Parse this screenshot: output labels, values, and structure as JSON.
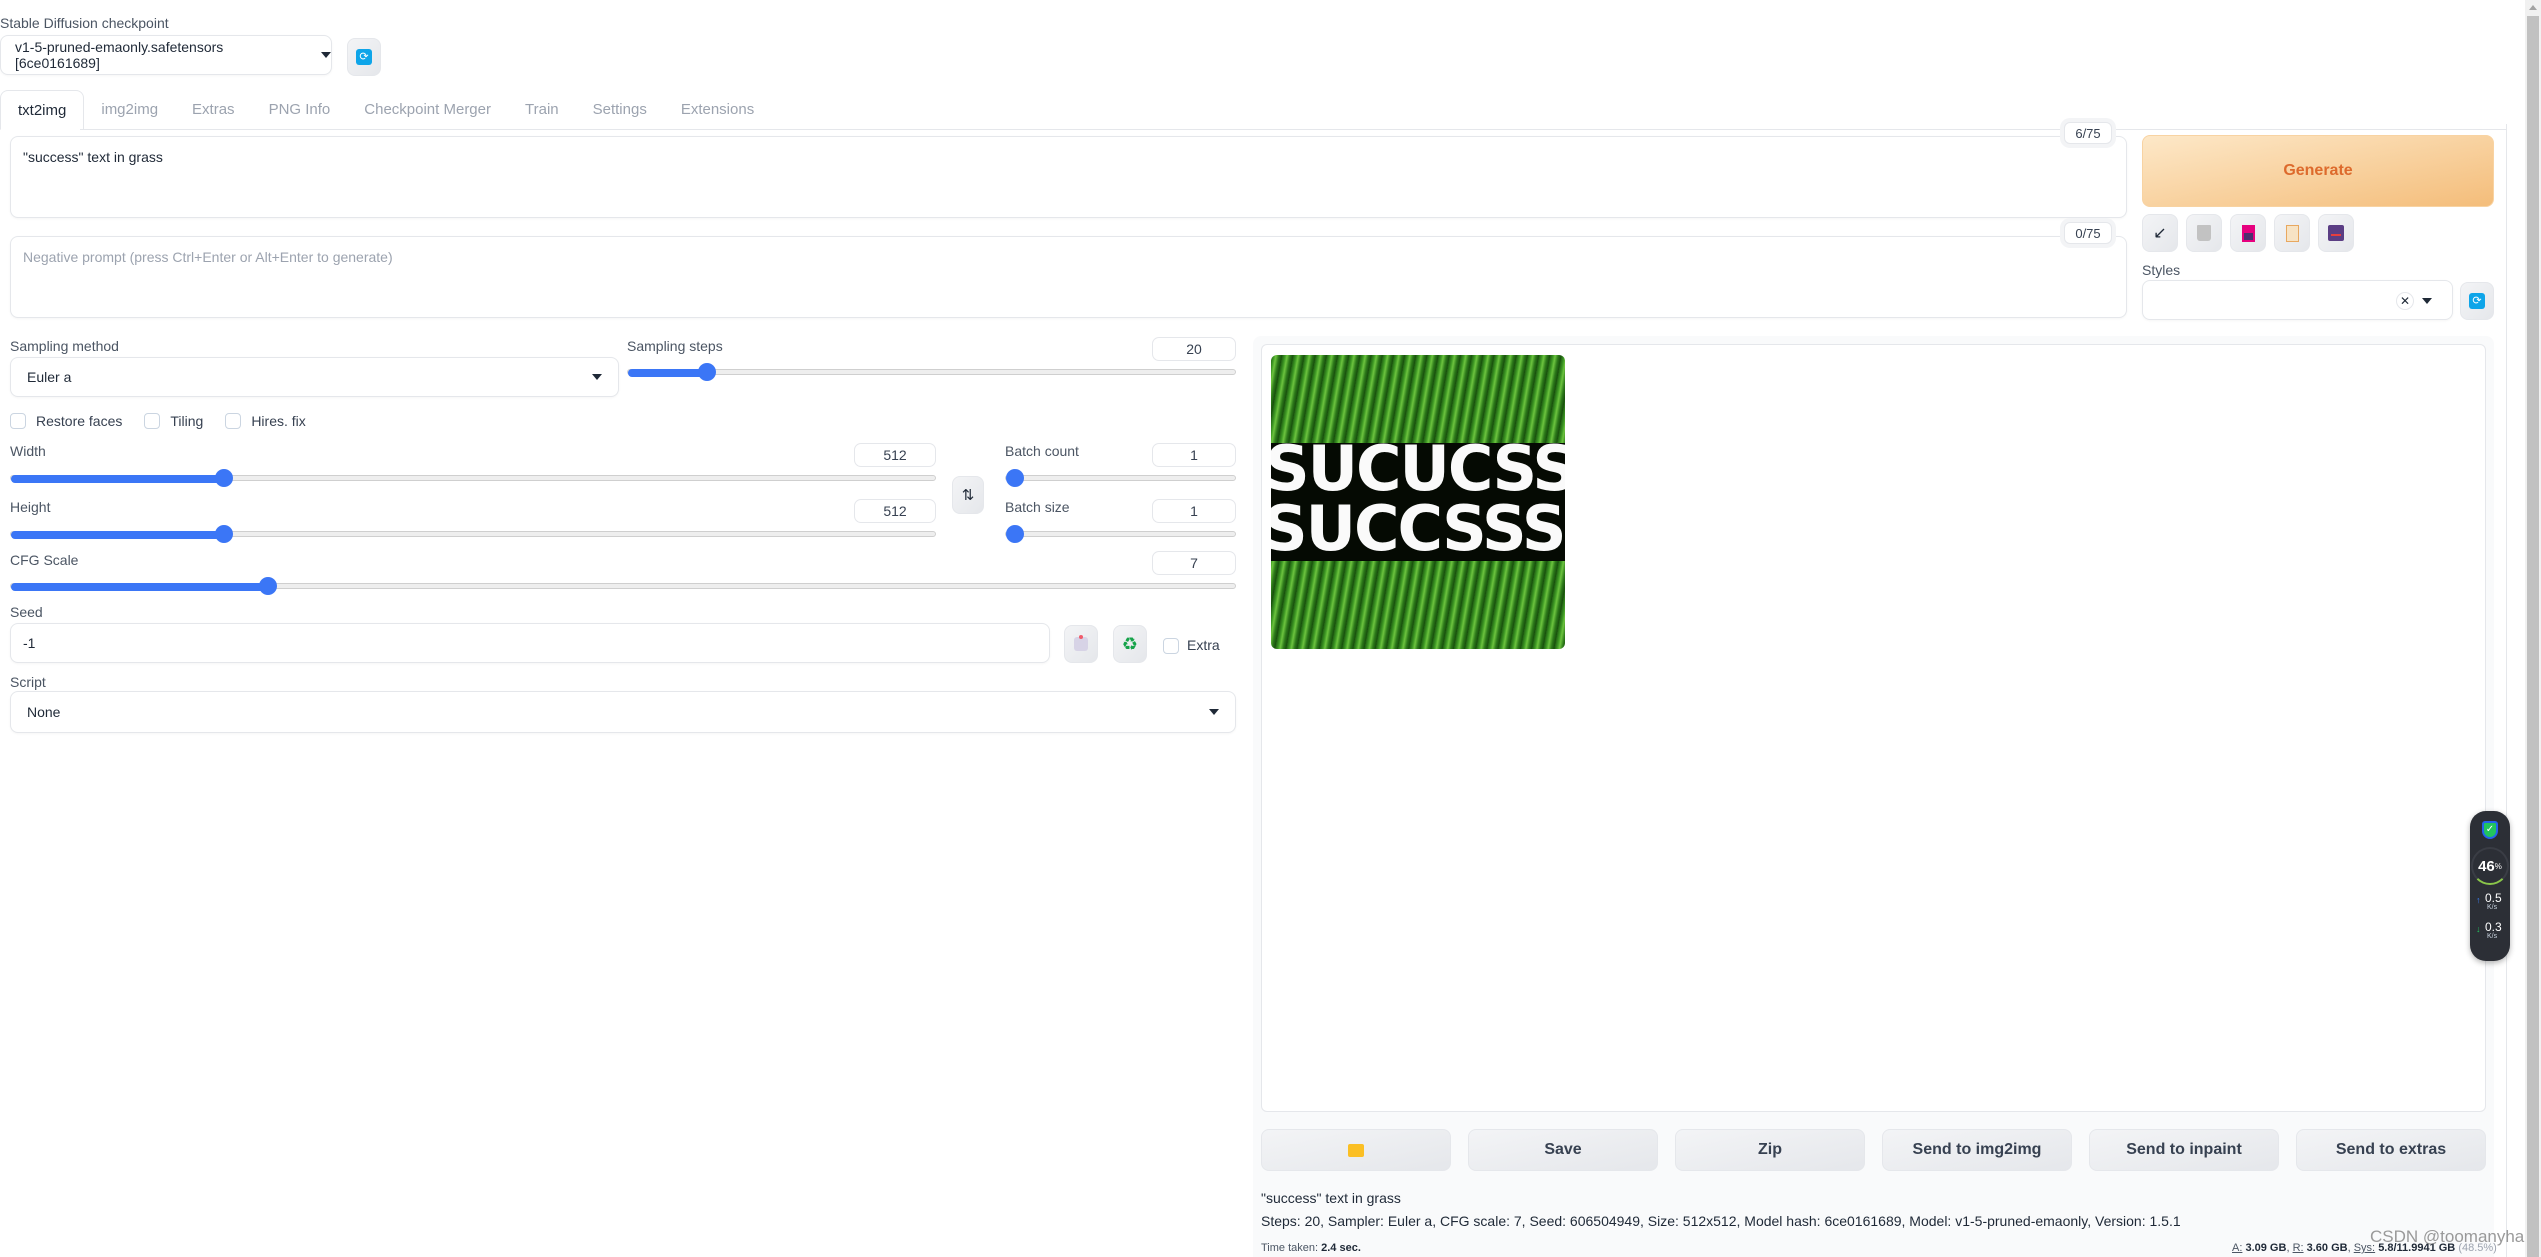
{
  "checkpoint": {
    "label": "Stable Diffusion checkpoint",
    "value": "v1-5-pruned-emaonly.safetensors [6ce0161689]"
  },
  "tabs": [
    {
      "label": "txt2img",
      "active": true
    },
    {
      "label": "img2img"
    },
    {
      "label": "Extras"
    },
    {
      "label": "PNG Info"
    },
    {
      "label": "Checkpoint Merger"
    },
    {
      "label": "Train"
    },
    {
      "label": "Settings"
    },
    {
      "label": "Extensions"
    }
  ],
  "prompt": {
    "value": "\"success\" text in grass",
    "token_count": "6/75"
  },
  "negative_prompt": {
    "placeholder": "Negative prompt (press Ctrl+Enter or Alt+Enter to generate)",
    "token_count": "0/75"
  },
  "generate": {
    "label": "Generate",
    "tools": [
      "apply-arrow-icon",
      "trash-icon",
      "picture-icon",
      "clipboard-icon",
      "save-disk-icon"
    ]
  },
  "styles": {
    "label": "Styles",
    "value": ""
  },
  "sampling": {
    "method_label": "Sampling method",
    "method_value": "Euler a",
    "steps_label": "Sampling steps",
    "steps_value": "20",
    "steps_fraction": 0.13
  },
  "checkboxes": [
    {
      "label": "Restore faces",
      "checked": false
    },
    {
      "label": "Tiling",
      "checked": false
    },
    {
      "label": "Hires. fix",
      "checked": false
    }
  ],
  "width": {
    "label": "Width",
    "value": "512",
    "fraction": 0.23
  },
  "height": {
    "label": "Height",
    "value": "512",
    "fraction": 0.23
  },
  "batch_count": {
    "label": "Batch count",
    "value": "1",
    "fraction": 0.0
  },
  "batch_size": {
    "label": "Batch size",
    "value": "1",
    "fraction": 0.0
  },
  "cfg": {
    "label": "CFG Scale",
    "value": "7",
    "fraction": 0.21
  },
  "seed": {
    "label": "Seed",
    "value": "-1",
    "extra_label": "Extra"
  },
  "script": {
    "label": "Script",
    "value": "None"
  },
  "output": {
    "image_text_line1": "SUCUCSS",
    "image_text_line2": "SUCCSSS",
    "buttons": [
      "",
      "Save",
      "Zip",
      "Send to img2img",
      "Send to inpaint",
      "Send to extras"
    ],
    "info_prompt": "\"success\" text in grass",
    "info_params": "Steps: 20, Sampler: Euler a, CFG scale: 7, Seed: 606504949, Size: 512x512, Model hash: 6ce0161689, Model: v1-5-pruned-emaonly, Version: 1.5.1",
    "time_label": "Time taken:",
    "time_value": "2.4 sec.",
    "vram": {
      "a_label": "A:",
      "a_value": "3.09 GB",
      "r_label": "R:",
      "r_value": "3.60 GB",
      "sys_label": "Sys:",
      "sys_value": "5.8/11.9941 GB",
      "sys_pct": "(48.5%)"
    }
  },
  "net_widget": {
    "percent": "46",
    "percent_sign": "%",
    "up": "0.5",
    "up_unit": "K/s",
    "down": "0.3",
    "down_unit": "K/s"
  },
  "watermark": "CSDN @toomanyhair"
}
